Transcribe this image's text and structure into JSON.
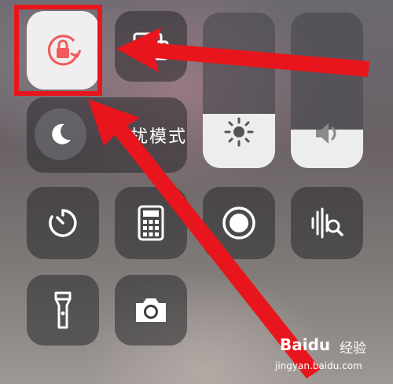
{
  "control_center": {
    "do_not_disturb": {
      "label": "勿扰模式",
      "visible_label": "扰模式",
      "icon": "moon-icon"
    },
    "tiles": [
      {
        "name": "rotation-lock",
        "icon": "rotation-lock-icon",
        "state": "on"
      },
      {
        "name": "screen-mirroring",
        "icon": "screen-mirroring-icon"
      },
      {
        "name": "timer",
        "icon": "timer-icon"
      },
      {
        "name": "calculator",
        "icon": "calculator-icon"
      },
      {
        "name": "screen-recording",
        "icon": "record-icon"
      },
      {
        "name": "sound-recognition",
        "icon": "sound-recognition-icon"
      },
      {
        "name": "flashlight",
        "icon": "flashlight-icon"
      },
      {
        "name": "camera",
        "icon": "camera-icon"
      }
    ],
    "brightness": {
      "icon": "sun-icon",
      "level": 0.35
    },
    "volume": {
      "icon": "speaker-icon",
      "level": 0.25
    }
  },
  "annotation": {
    "highlight_color": "#e8161c",
    "arrow_color": "#e8161c"
  },
  "watermark": {
    "brand": "Baidu",
    "suffix": "经验",
    "url": "jingyan.baidu.com"
  }
}
